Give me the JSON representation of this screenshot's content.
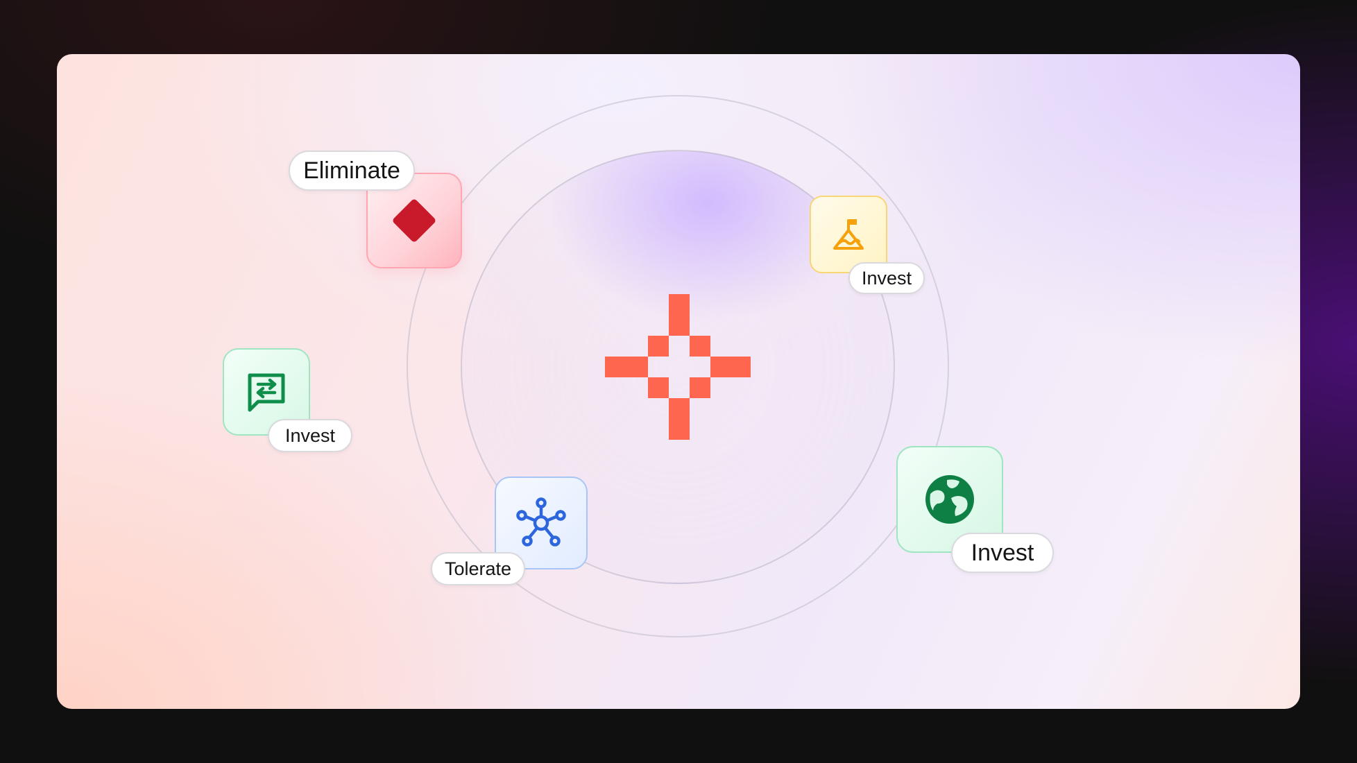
{
  "labels": {
    "eliminate": "Eliminate",
    "invest_mountain": "Invest",
    "invest_chat": "Invest",
    "tolerate": "Tolerate",
    "invest_globe": "Invest"
  },
  "icons": {
    "center": "plus-pixel-logo-icon",
    "eliminate": "diamond-icon",
    "invest_mountain": "mountain-flag-icon",
    "invest_chat": "chat-exchange-icon",
    "tolerate": "network-hub-icon",
    "invest_globe": "globe-icon"
  },
  "colors": {
    "logo": "#ff6650",
    "diamond": "#c81a2b",
    "mountain": "#f5a10c",
    "chat": "#0f8e4b",
    "network": "#2d66dc",
    "globe": "#0f8045"
  }
}
